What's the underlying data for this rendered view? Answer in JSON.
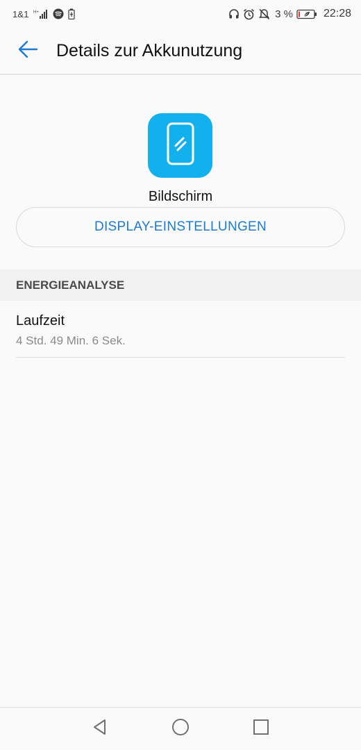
{
  "status_bar": {
    "carrier": "1&1",
    "battery_percent": "3 %",
    "time": "22:28",
    "icons": [
      "signal-icon",
      "spotify-icon",
      "battery-saver-icon",
      "headphones-icon",
      "alarm-icon",
      "mute-icon",
      "battery-icon"
    ]
  },
  "app_bar": {
    "title": "Details zur Akkunutzung",
    "back_icon": "back-arrow-icon"
  },
  "app": {
    "name": "Bildschirm",
    "icon": "phone-screen-icon",
    "icon_color": "#12b0ec"
  },
  "actions": {
    "display_settings_label": "DISPLAY-EINSTELLUNGEN",
    "accent_color": "#1a7ad4"
  },
  "section": {
    "header": "ENERGIEANALYSE",
    "runtime_label": "Laufzeit",
    "runtime_value": "4 Std. 49 Min. 6 Sek."
  },
  "nav_bar": {
    "buttons": [
      "back-triangle-icon",
      "home-circle-icon",
      "recents-square-icon"
    ]
  }
}
